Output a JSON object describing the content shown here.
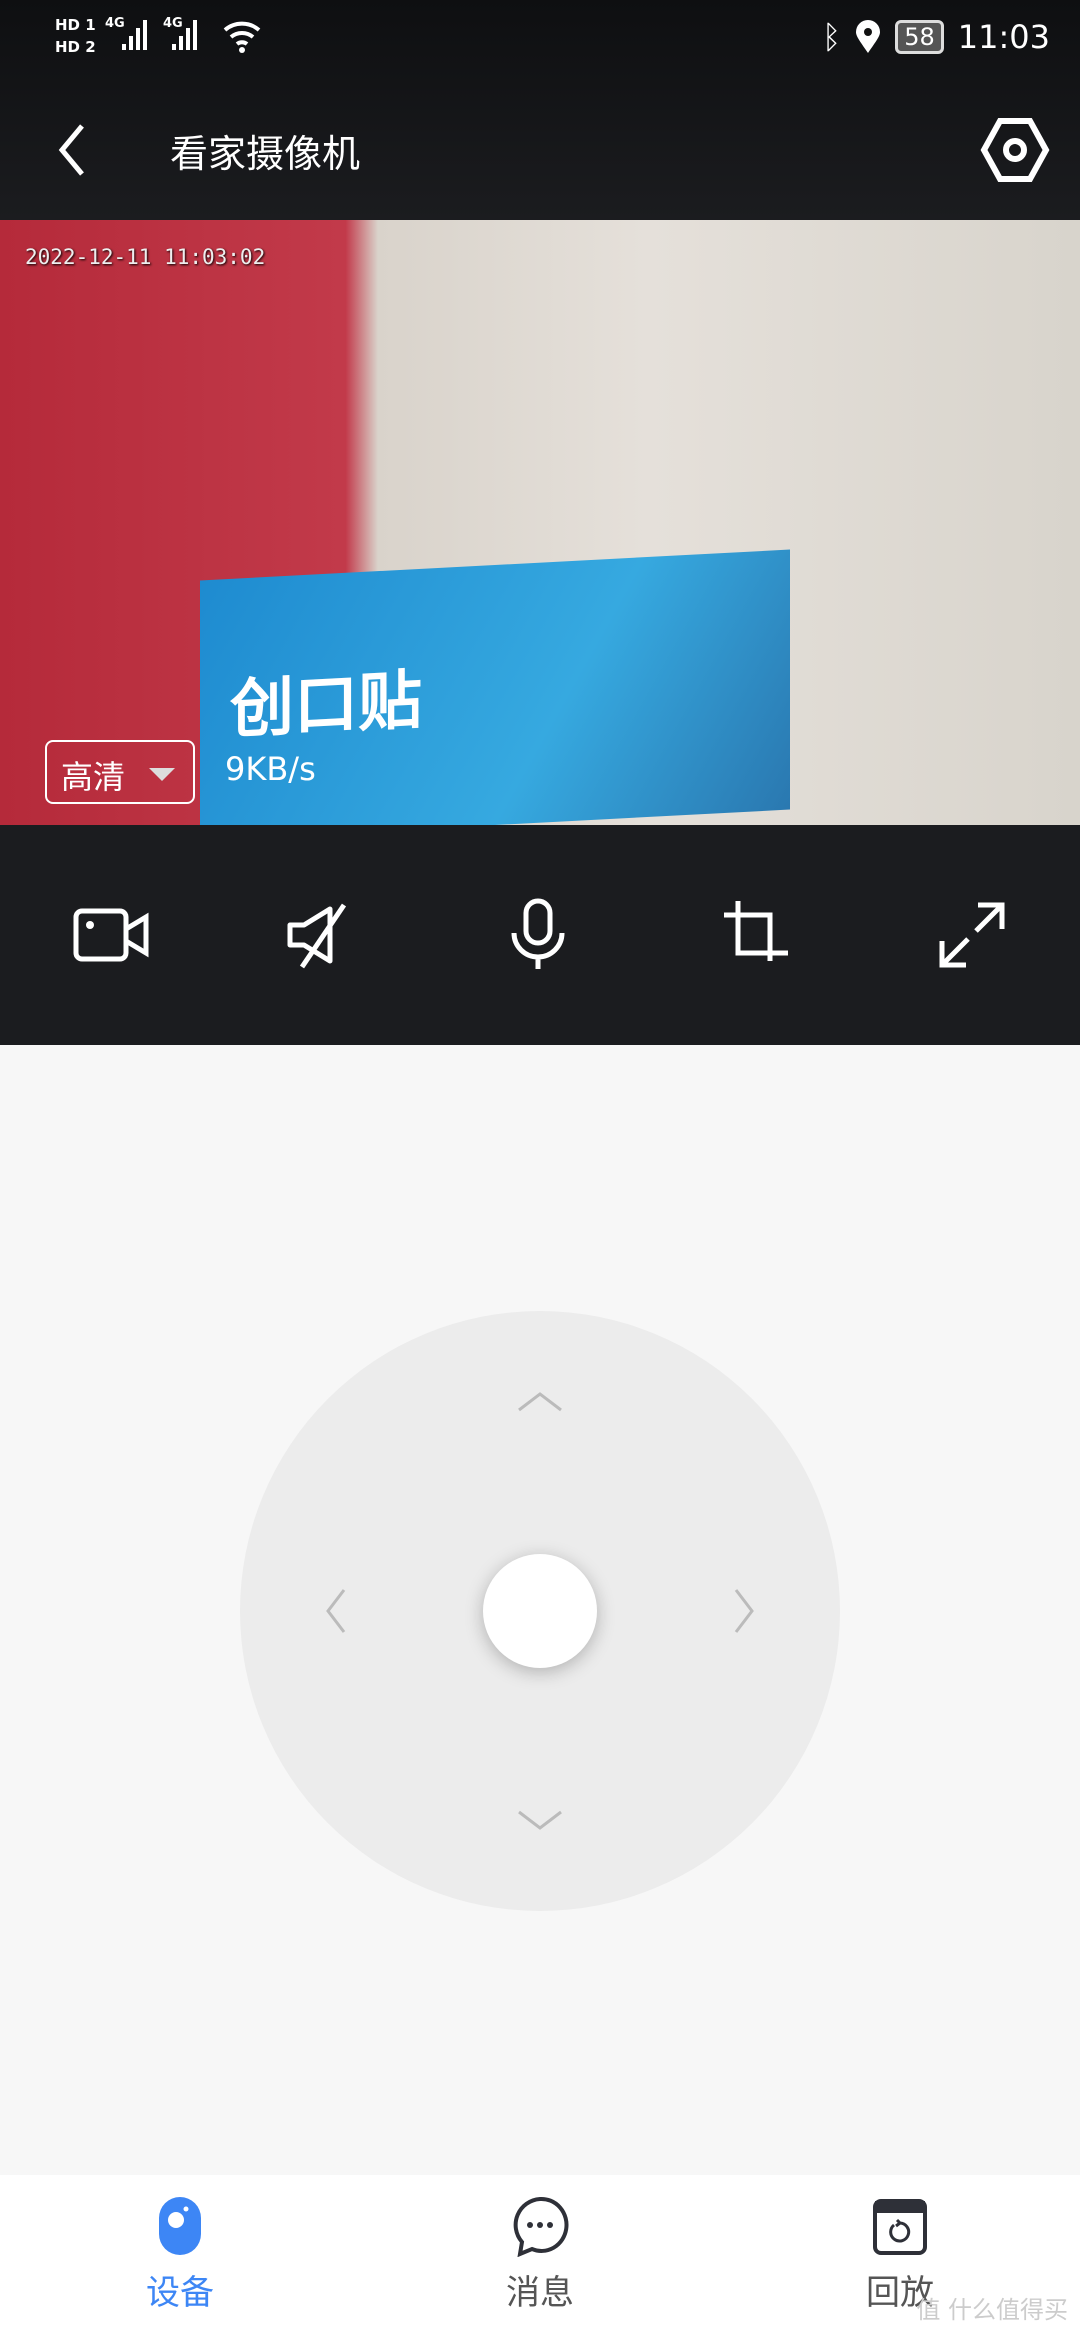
{
  "status_bar": {
    "sim1": "HD 1",
    "sim2": "HD 2",
    "net1": "4G",
    "net2": "4G",
    "battery": "58",
    "time": "11:03"
  },
  "header": {
    "title": "看家摄像机",
    "back_icon": "chevron-left-icon",
    "settings_icon": "hexagon-gear-icon"
  },
  "video": {
    "timestamp": "2022-12-11 11:03:02",
    "quality": "高清",
    "speed": "9KB/s",
    "scene_text": "创口贴"
  },
  "controls": [
    "video-record-icon",
    "mute-icon",
    "microphone-icon",
    "crop-icon",
    "fullscreen-icon"
  ],
  "ptz": {
    "directions": [
      "up",
      "down",
      "left",
      "right"
    ]
  },
  "nav": {
    "tabs": [
      {
        "label": "设备",
        "active": true
      },
      {
        "label": "消息",
        "active": false
      },
      {
        "label": "回放",
        "active": false
      }
    ],
    "accent": "#3d86f5"
  },
  "watermark": "值 什么值得买"
}
